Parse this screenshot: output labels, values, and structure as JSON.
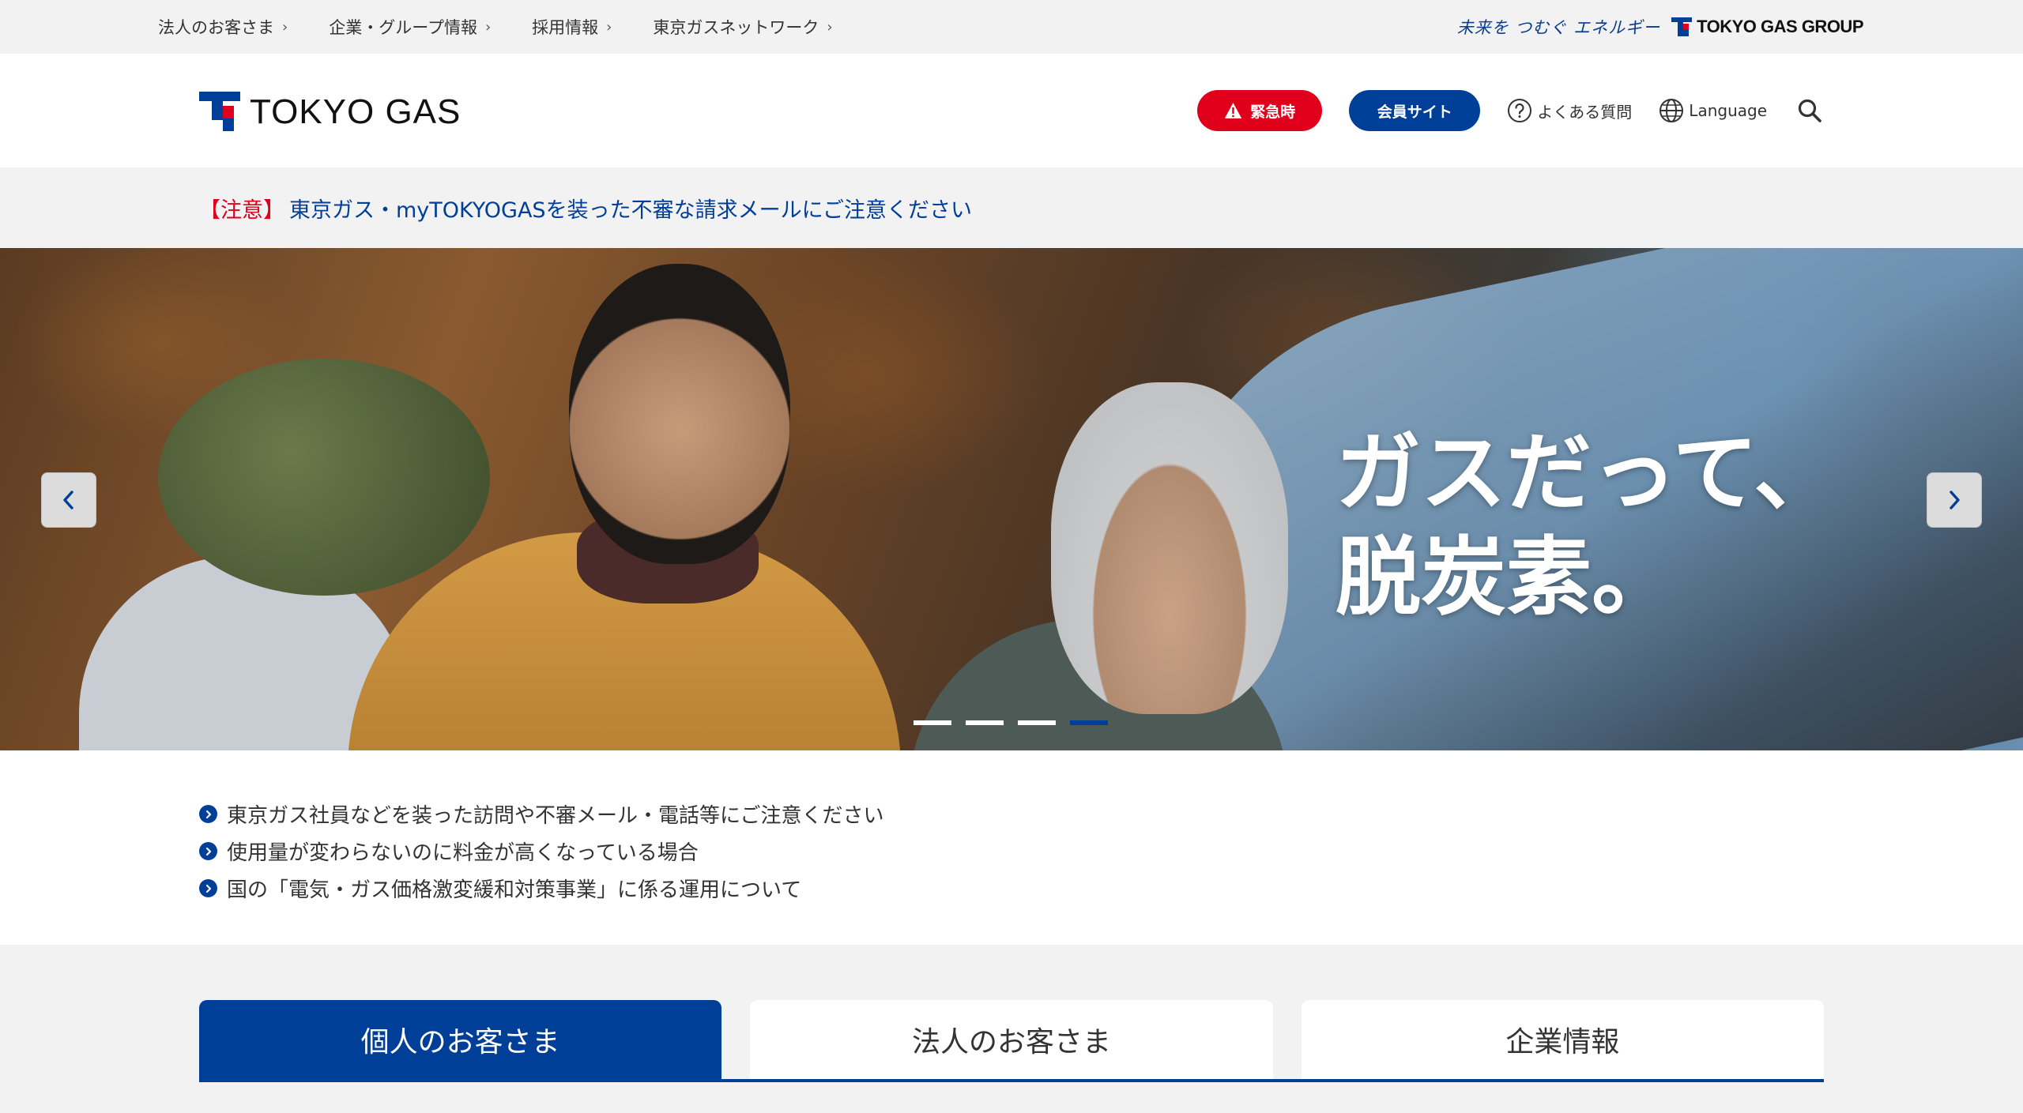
{
  "utility_nav": {
    "links": [
      {
        "label": "法人のお客さま"
      },
      {
        "label": "企業・グループ情報"
      },
      {
        "label": "採用情報"
      },
      {
        "label": "東京ガスネットワーク"
      }
    ],
    "chevron": "›",
    "tagline": "未来を つむぐ エネルギー",
    "group_logo_text": "TOKYO GAS GROUP"
  },
  "header": {
    "logo_text": "TOKYO GAS",
    "emergency_label": "緊急時",
    "member_label": "会員サイト",
    "faq_label": "よくある質問",
    "language_label": "Language",
    "icons": {
      "warning": "warning-icon",
      "faq": "question-circle-icon",
      "language": "globe-icon",
      "search": "search-icon"
    }
  },
  "notice": {
    "tag": "【注意】",
    "text": "東京ガス・myTOKYOGASを装った不審な請求メールにご注意ください"
  },
  "hero": {
    "copy_line1": "ガスだって、",
    "copy_line2": "脱炭素。",
    "slide_count": 4,
    "active_slide": 4
  },
  "alerts": [
    {
      "text": "東京ガス社員などを装った訪問や不審メール・電話等にご注意ください"
    },
    {
      "text": "使用量が変わらないのに料金が高くなっている場合"
    },
    {
      "text": "国の「電気・ガス価格激変緩和対策事業」に係る運用について"
    }
  ],
  "segment_tabs": [
    {
      "label": "個人のお客さま",
      "active": true
    },
    {
      "label": "法人のお客さま",
      "active": false
    },
    {
      "label": "企業情報",
      "active": false
    }
  ],
  "colors": {
    "brand_blue": "#003f98",
    "emergency_red": "#e0001b",
    "band_gray": "#f2f2f2"
  }
}
